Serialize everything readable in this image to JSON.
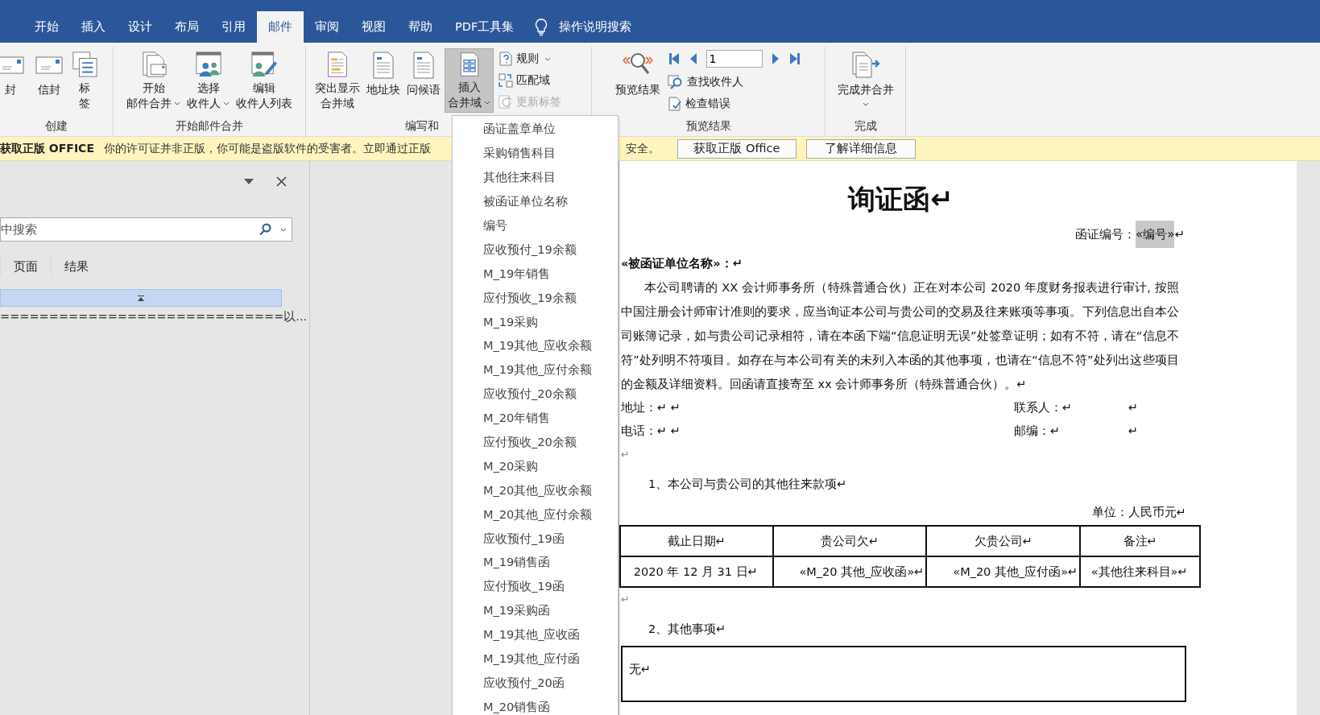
{
  "tabs": [
    {
      "label": "开始",
      "selected": false
    },
    {
      "label": "插入",
      "selected": false
    },
    {
      "label": "设计",
      "selected": false
    },
    {
      "label": "布局",
      "selected": false
    },
    {
      "label": "引用",
      "selected": false
    },
    {
      "label": "邮件",
      "selected": true
    },
    {
      "label": "审阅",
      "selected": false
    },
    {
      "label": "视图",
      "selected": false
    },
    {
      "label": "帮助",
      "selected": false
    },
    {
      "label": "PDF工具集",
      "selected": false
    }
  ],
  "tell_me": "操作说明搜索",
  "groups": [
    {
      "label": "创建",
      "items": [
        {
          "kind": "big",
          "lines": [
            "封"
          ],
          "menu": false,
          "pressed": false
        },
        {
          "kind": "big",
          "lines": [
            "信封"
          ],
          "menu": false,
          "pressed": false
        },
        {
          "kind": "big",
          "lines": [
            "标",
            "签"
          ],
          "menu": false,
          "pressed": false
        }
      ]
    },
    {
      "label": "开始邮件合并",
      "items": [
        {
          "kind": "big",
          "lines": [
            "开始",
            "邮件合并"
          ],
          "menu": true,
          "pressed": false
        },
        {
          "kind": "big",
          "lines": [
            "选择",
            "收件人"
          ],
          "menu": true,
          "pressed": false
        },
        {
          "kind": "big",
          "lines": [
            "编辑",
            "收件人列表"
          ],
          "menu": false,
          "pressed": false
        }
      ]
    },
    {
      "label": "编写和",
      "items": [
        {
          "kind": "big",
          "lines": [
            "突出显示",
            "合并域"
          ],
          "menu": false,
          "pressed": false
        },
        {
          "kind": "big",
          "lines": [
            "地址块"
          ],
          "menu": false,
          "pressed": false
        },
        {
          "kind": "big",
          "lines": [
            "问候语"
          ],
          "menu": false,
          "pressed": false
        },
        {
          "kind": "big",
          "lines": [
            "插入",
            "合并域"
          ],
          "menu": true,
          "pressed": true
        },
        {
          "kind": "stack",
          "entries": [
            {
              "label": "规则",
              "menu": true,
              "disabled": false
            },
            {
              "label": "匹配域",
              "menu": false,
              "disabled": false
            },
            {
              "label": "更新标签",
              "menu": false,
              "disabled": true
            }
          ]
        }
      ]
    },
    {
      "label": "预览结果",
      "items": [
        {
          "kind": "big",
          "lines": [
            "预览结果"
          ],
          "menu": false,
          "pressed": false
        },
        {
          "kind": "nav",
          "record": "1",
          "entries": [
            {
              "label": "查找收件人",
              "menu": false,
              "disabled": false
            },
            {
              "label": "检查错误",
              "menu": false,
              "disabled": false
            }
          ]
        }
      ]
    },
    {
      "label": "完成",
      "items": [
        {
          "kind": "big",
          "lines": [
            "完成并合并"
          ],
          "menu": true,
          "pressed": false
        }
      ]
    }
  ],
  "notice": {
    "title": "获取正版 OFFICE",
    "message": "你的许可证并非正版，你可能是盗版软件的受害者。立即通过正版",
    "message_end": "安全。",
    "buttons": [
      "获取正版 Office",
      "了解详细信息"
    ]
  },
  "nav_pane": {
    "search_placeholder": "中搜索",
    "tabs": [
      {
        "label": "页面",
        "selected": false
      },
      {
        "label": "结果",
        "selected": false
      }
    ],
    "result": "=============================以..."
  },
  "field_menu": [
    "函证盖章单位",
    "采购销售科目",
    "其他往来科目",
    "被函证单位名称",
    "编号",
    "应收预付_19余额",
    "M_19年销售",
    "应付预收_19余额",
    "M_19采购",
    "M_19其他_应收余额",
    "M_19其他_应付余额",
    "应收预付_20余额",
    "M_20年销售",
    "应付预收_20余额",
    "M_20采购",
    "M_20其他_应收余额",
    "M_20其他_应付余额",
    "应收预付_19函",
    "M_19销售函",
    "应付预收_19函",
    "M_19采购函",
    "M_19其他_应收函",
    "M_19其他_应付函",
    "应收预付_20函",
    "M_20销售函"
  ],
  "document": [
    {
      "kind": "title",
      "text": "询证函↵"
    },
    {
      "kind": "ref",
      "label": "函证编号：",
      "field": "«编号»",
      "end": "↵"
    },
    {
      "kind": "addressee",
      "text": "«被函证单位名称»：↵"
    },
    {
      "kind": "para",
      "text": "本公司聘请的 XX 会计师事务所（特殊普通合伙）正在对本公司 2020 年度财务报表进行审计, 按照中国注册会计师审计准则的要求，应当询证本公司与贵公司的交易及往来账项等事项。下列信息出自本公司账簿记录，如与贵公司记录相符，请在本函下端“信息证明无误”处签章证明；如有不符，请在“信息不符”处列明不符项目。如存在与本公司有关的未列入本函的其他事项，也请在“信息不符”处列出这些项目的金额及详细资料。回函请直接寄至 xx 会计师事务所（特殊普通合伙）。↵"
    },
    {
      "kind": "contact",
      "left": "地址：↵  ↵",
      "right": "联系人：↵",
      "right_end": "↵"
    },
    {
      "kind": "contact",
      "left": "电话：↵  ↵",
      "right": "邮编：↵",
      "right_end": "↵"
    },
    {
      "kind": "blank",
      "text": "↵"
    },
    {
      "kind": "section",
      "text": "1、本公司与贵公司的其他往来款项↵"
    },
    {
      "kind": "unit",
      "text": "单位：人民币元↵"
    },
    {
      "kind": "table",
      "columns": [
        "截止日期↵",
        "贵公司欠↵",
        "欠贵公司↵",
        "备注↵"
      ],
      "rows": [
        [
          "2020 年 12 月 31 日↵",
          "«M_20 其他_应收函»↵",
          "«M_20 其他_应付函»↵",
          "«其他往来科目»↵"
        ]
      ]
    },
    {
      "kind": "blank",
      "text": "↵"
    },
    {
      "kind": "section",
      "text": "2、其他事项↵"
    },
    {
      "kind": "box",
      "text": "无↵"
    }
  ]
}
